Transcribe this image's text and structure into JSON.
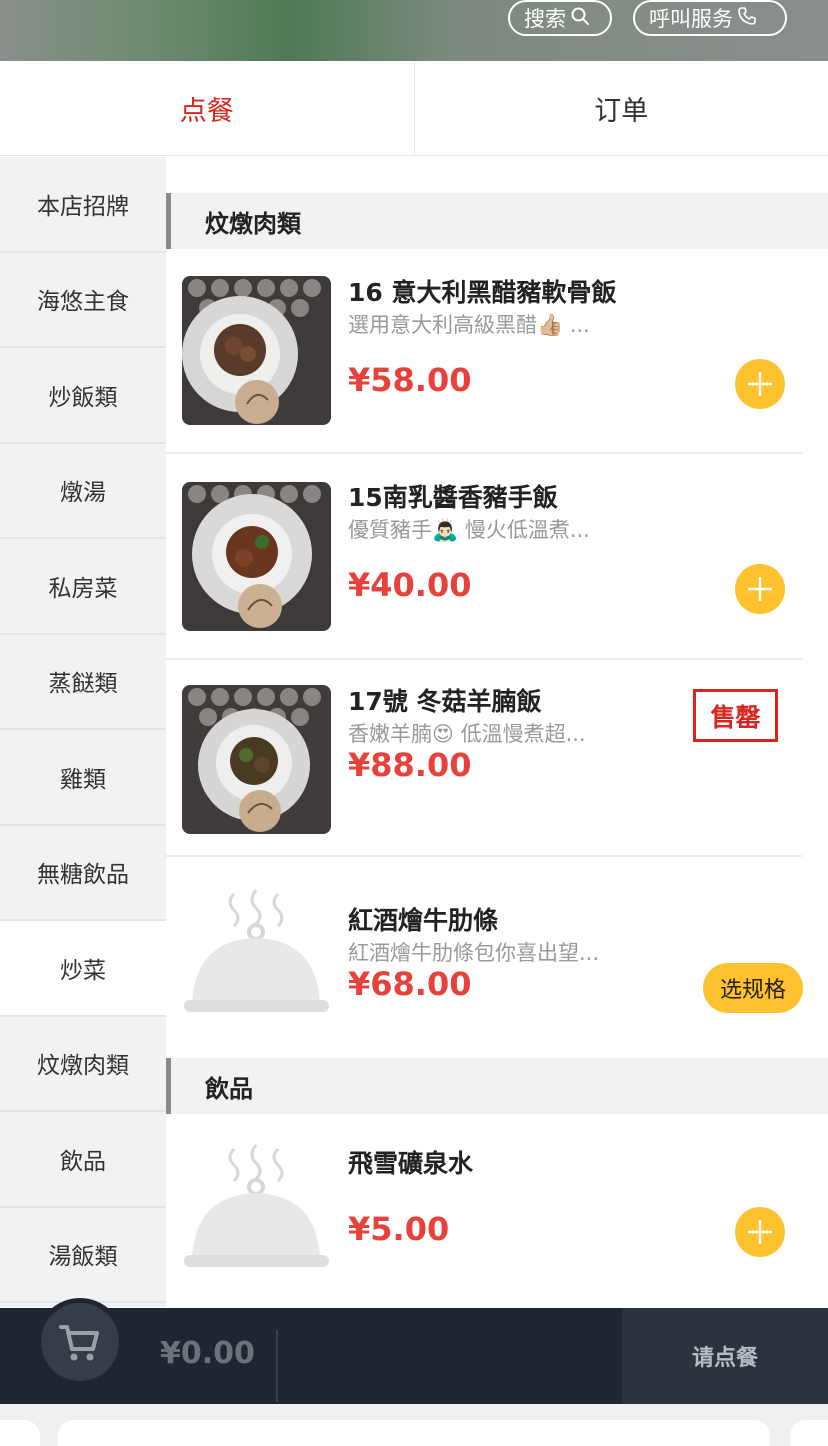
{
  "header": {
    "search_label": "搜索",
    "call_label": "呼叫服务",
    "search_icon": "search-icon",
    "call_icon": "phone-icon"
  },
  "tabs": [
    {
      "label": "点餐",
      "active": true
    },
    {
      "label": "订单",
      "active": false
    }
  ],
  "sidebar": {
    "items": [
      {
        "label": "本店招牌"
      },
      {
        "label": "海悠主食"
      },
      {
        "label": "炒飯類"
      },
      {
        "label": "燉湯"
      },
      {
        "label": "私房菜"
      },
      {
        "label": "蒸餸類"
      },
      {
        "label": "雞類"
      },
      {
        "label": "無糖飲品"
      },
      {
        "label": "炒菜",
        "active": true
      },
      {
        "label": "炆燉肉類"
      },
      {
        "label": "飲品"
      },
      {
        "label": "湯飯類"
      }
    ]
  },
  "sections": [
    {
      "title": "炆燉肉類",
      "items": [
        {
          "name": "16 意大利黑醋豬軟骨飯",
          "desc": "選用意大利高級黑醋👍🏼 ...",
          "price": "¥58.00",
          "action": "add"
        },
        {
          "name": "15南乳醬香豬手飯",
          "desc": "優質豬手🙇🏻‍♂️ 慢火低溫煮...",
          "price": "¥40.00",
          "action": "add"
        },
        {
          "name": "17號 冬菇羊腩飯",
          "desc": "香嫩羊腩😍 低溫慢煮超...",
          "price": "¥88.00",
          "action": "soldout",
          "soldout_label": "售罄"
        },
        {
          "name": "紅酒燴牛肋條",
          "desc": "紅酒燴牛肋條包你喜出望...",
          "price": "¥68.00",
          "action": "spec",
          "spec_label": "选规格"
        }
      ]
    },
    {
      "title": "飲品",
      "items": [
        {
          "name": "飛雪礦泉水",
          "desc": "",
          "price": "¥5.00",
          "action": "add"
        }
      ]
    }
  ],
  "cart": {
    "total": "¥0.00",
    "checkout_label": "请点餐",
    "icon": "cart-icon"
  },
  "colors": {
    "accent_red": "#d9251d",
    "price_red": "#e8403a",
    "button_yellow": "#ffc12e",
    "cart_bar": "#1f2630"
  }
}
